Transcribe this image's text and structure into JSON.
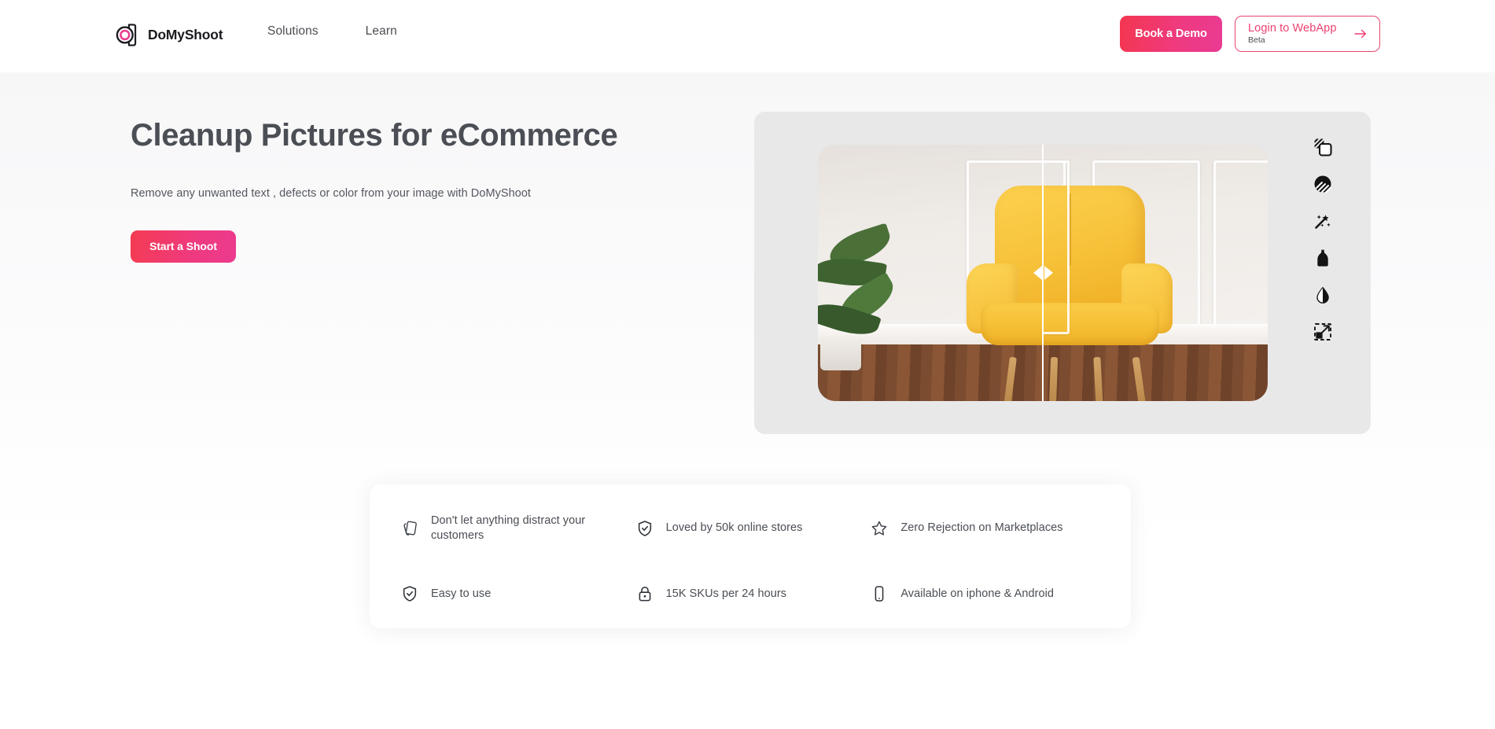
{
  "brand": {
    "name": "DoMyShoot",
    "logo_icon": "camera-aperture-icon",
    "accent_pink": "#ec3a8e",
    "accent_red": "#f43b52"
  },
  "header": {
    "nav": [
      {
        "label": "Solutions",
        "name": "nav-link-solutions"
      },
      {
        "label": "Learn",
        "name": "nav-link-learn"
      }
    ],
    "demo_button": "Book a Demo",
    "login_button": {
      "main": "Login to WebApp",
      "sub": "Beta",
      "arrow_icon": "arrow-right-icon"
    }
  },
  "hero": {
    "title": "Cleanup Pictures for eCommerce",
    "subtitle": "Remove any unwanted text , defects or color from your image with DoMyShoot",
    "cta": "Start a Shoot"
  },
  "hero_media": {
    "comparison_alt": "Yellow armchair before and after cleanup",
    "slider_handle_icon": "compare-slider-handle-icon",
    "tools": [
      {
        "name": "background-remove-icon",
        "label": "Background Removal"
      },
      {
        "name": "shade-circle-icon",
        "label": "Shadow / Shade"
      },
      {
        "name": "magic-wand-icon",
        "label": "Magic Cleanup"
      },
      {
        "name": "mannequin-icon",
        "label": "Ghost Mannequin"
      },
      {
        "name": "water-drop-icon",
        "label": "Color & Contrast"
      },
      {
        "name": "resize-expand-icon",
        "label": "Resize / Expand"
      }
    ]
  },
  "features": [
    {
      "icon": "cards-stack-icon",
      "label": "Don't let anything distract your customers"
    },
    {
      "icon": "shield-check-icon",
      "label": "Loved by 50k online stores"
    },
    {
      "icon": "star-icon",
      "label": "Zero Rejection on Marketplaces"
    },
    {
      "icon": "shield-check-icon",
      "label": "Easy to use"
    },
    {
      "icon": "lock-icon",
      "label": "15K SKUs per 24 hours"
    },
    {
      "icon": "smartphone-icon",
      "label": "Available on iphone & Android"
    }
  ]
}
